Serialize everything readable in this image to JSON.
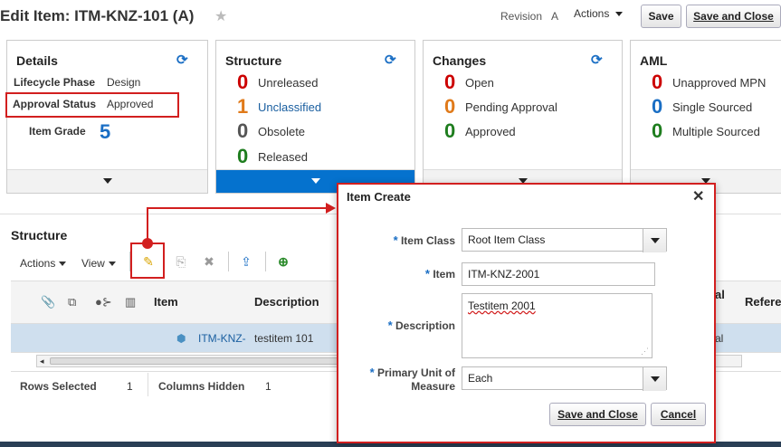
{
  "header": {
    "title": "Edit Item: ITM-KNZ-101 (A)",
    "star": "★",
    "revision_label": "Revision",
    "revision_value": "A",
    "actions_label": "Actions",
    "save_label": "Save",
    "save_close_label": "Save and Close"
  },
  "cards": {
    "details": {
      "title": "Details",
      "lifecycle_label": "Lifecycle Phase",
      "lifecycle_value": "Design",
      "approval_label": "Approval Status",
      "approval_value": "Approved",
      "grade_label": "Item Grade",
      "grade_value": "5"
    },
    "structure": {
      "title": "Structure",
      "rows": [
        {
          "count": "0",
          "label": "Unreleased"
        },
        {
          "count": "1",
          "label": "Unclassified"
        },
        {
          "count": "0",
          "label": "Obsolete"
        },
        {
          "count": "0",
          "label": "Released"
        }
      ]
    },
    "changes": {
      "title": "Changes",
      "rows": [
        {
          "count": "0",
          "label": "Open"
        },
        {
          "count": "0",
          "label": "Pending Approval"
        },
        {
          "count": "0",
          "label": "Approved"
        }
      ]
    },
    "aml": {
      "title": "AML",
      "rows": [
        {
          "count": "0",
          "label": "Unapproved MPN"
        },
        {
          "count": "0",
          "label": "Single Sourced"
        },
        {
          "count": "0",
          "label": "Multiple Sourced"
        }
      ]
    }
  },
  "structure_section": {
    "title": "Structure",
    "actions_label": "Actions",
    "view_label": "View",
    "columns": {
      "item": "Item",
      "description": "Description",
      "al": "al",
      "reference": "Refere"
    },
    "row": {
      "item": "ITM-KNZ-",
      "description": "testitem 101",
      "extra": "al"
    },
    "rows_selected_label": "Rows Selected",
    "rows_selected_value": "1",
    "columns_hidden_label": "Columns Hidden",
    "columns_hidden_value": "1"
  },
  "dialog": {
    "title": "Item Create",
    "close": "✕",
    "item_class_label": "Item Class",
    "item_class_value": "Root Item Class",
    "item_label": "Item",
    "item_value": "ITM-KNZ-2001",
    "description_label": "Description",
    "description_value": "Testitem 2001",
    "uom_label_1": "Primary Unit of",
    "uom_label_2": "Measure",
    "uom_value": "Each",
    "required_mark": "*",
    "save_close_label": "Save and Close",
    "cancel_label": "Cancel"
  }
}
